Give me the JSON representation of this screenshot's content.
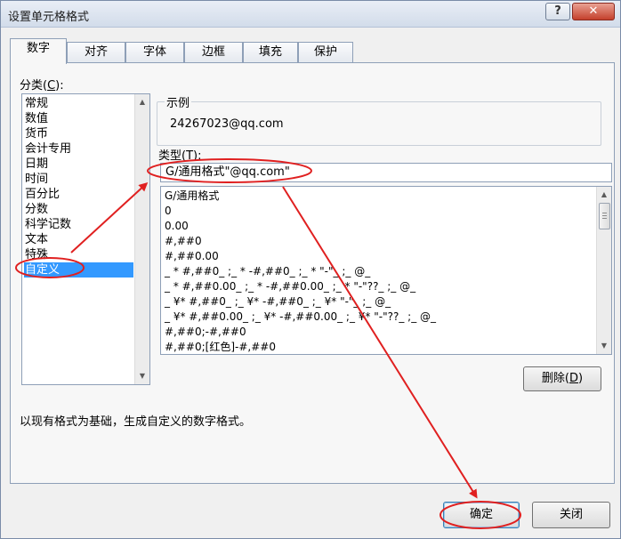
{
  "window": {
    "title": "设置单元格格式",
    "help_label": "?",
    "close_label": "✕"
  },
  "tabs": [
    "数字",
    "对齐",
    "字体",
    "边框",
    "填充",
    "保护"
  ],
  "category": {
    "label": "分类(",
    "label_key": "C",
    "label_end": "):",
    "items": [
      "常规",
      "数值",
      "货币",
      "会计专用",
      "日期",
      "时间",
      "百分比",
      "分数",
      "科学记数",
      "文本",
      "特殊",
      "自定义"
    ],
    "selected_index": 11
  },
  "sample": {
    "label": "示例",
    "value": "24267023@qq.com"
  },
  "type": {
    "label": "类型(",
    "label_key": "T",
    "label_end": "):",
    "value": "G/通用格式\"@qq.com\""
  },
  "formats": [
    "G/通用格式",
    "0",
    "0.00",
    "#,##0",
    "#,##0.00",
    "_ * #,##0_ ;_ * -#,##0_ ;_ * \"-\"_ ;_ @_",
    "_ * #,##0.00_ ;_ * -#,##0.00_ ;_ * \"-\"??_ ;_ @_",
    "_ ¥* #,##0_ ;_ ¥* -#,##0_ ;_ ¥* \"-\"_ ;_ @_",
    "_ ¥* #,##0.00_ ;_ ¥* -#,##0.00_ ;_ ¥* \"-\"??_ ;_ @_",
    "#,##0;-#,##0",
    "#,##0;[红色]-#,##0"
  ],
  "delete_button": {
    "label": "删除(",
    "key": "D",
    "end": ")"
  },
  "description": "以现有格式为基础，生成自定义的数字格式。",
  "ok_label": "确定",
  "cancel_label": "关闭",
  "annotation_color": "#e02020"
}
